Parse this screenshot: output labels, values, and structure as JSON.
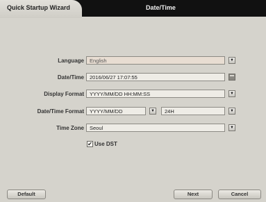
{
  "tabs": {
    "wizard": "Quick Startup Wizard",
    "title": "Date/Time"
  },
  "form": {
    "language": {
      "label": "Language",
      "value": "English"
    },
    "datetime": {
      "label": "Date/Time",
      "value": "2016/06/27 17:07:55"
    },
    "display_format": {
      "label": "Display Format",
      "value": "YYYY/MM/DD HH:MM:SS"
    },
    "datetime_format": {
      "label": "Date/Time Format",
      "value": "YYYY/MM/DD",
      "hour_value": "24H"
    },
    "time_zone": {
      "label": "Time Zone",
      "value": "Seoul"
    },
    "dst": {
      "label": "Use DST",
      "checked": true,
      "check_glyph": "✔"
    }
  },
  "buttons": {
    "default": "Default",
    "next": "Next",
    "cancel": "Cancel"
  },
  "icons": {
    "dropdown_glyph": "▼"
  }
}
